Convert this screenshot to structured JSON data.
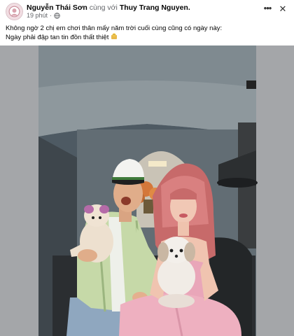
{
  "post": {
    "author": "Nguyễn Thái Sơn",
    "with_text": "cùng với",
    "tagged": "Thuy Trang Nguyen.",
    "time": "19 phút",
    "separator": "·",
    "more_icon": "more-options-icon",
    "close_icon": "close-icon",
    "caption_line1": "Không ngờ 2 chị em chơi thân mấy năm trời cuối cùng cũng có ngày này:",
    "caption_line2": "Ngày phải đập tan tin đồn thất thiệt",
    "caption_emoji": "smiling-face-emoji"
  },
  "colors": {
    "secondary_text": "#65676b",
    "photo_bg": "#a3a5a8"
  }
}
